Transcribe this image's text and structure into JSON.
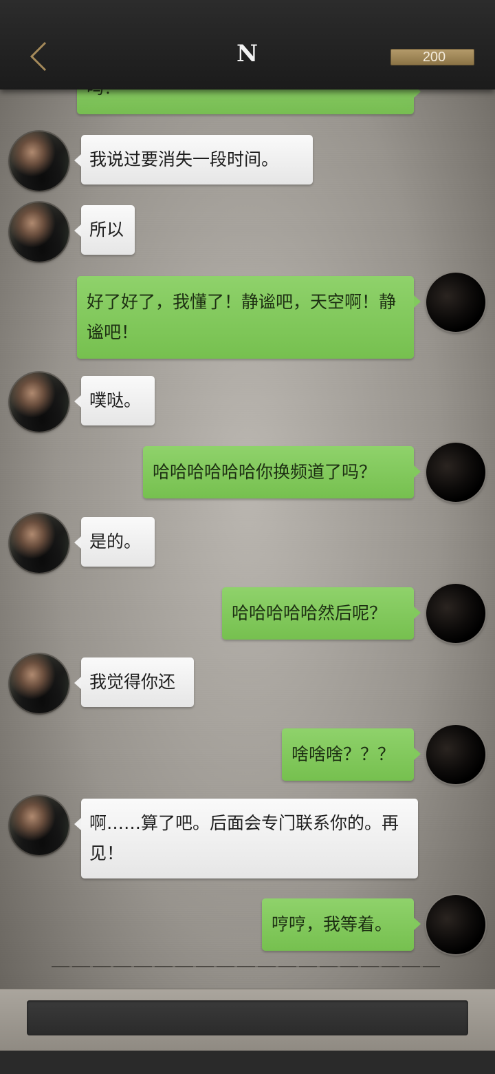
{
  "header": {
    "title": "N",
    "coins": "200"
  },
  "messages": [
    {
      "side": "out",
      "text": "吗？"
    },
    {
      "side": "in",
      "text": "我说过要消失一段时间。"
    },
    {
      "side": "in",
      "text": "所以"
    },
    {
      "side": "out",
      "text": "好了好了，我懂了！静谧吧，天空啊！静谧吧！"
    },
    {
      "side": "in",
      "text": "噗哒。"
    },
    {
      "side": "out",
      "text": "哈哈哈哈哈哈你换频道了吗？"
    },
    {
      "side": "in",
      "text": "是的。"
    },
    {
      "side": "out",
      "text": "哈哈哈哈哈然后呢？"
    },
    {
      "side": "in",
      "text": "我觉得你还"
    },
    {
      "side": "out",
      "text": "啥啥啥？？？"
    },
    {
      "side": "in",
      "text": "啊……算了吧。后面会专门联系你的。再见！"
    },
    {
      "side": "out",
      "text": "哼哼，我等着。"
    }
  ],
  "input": {
    "value": ""
  }
}
